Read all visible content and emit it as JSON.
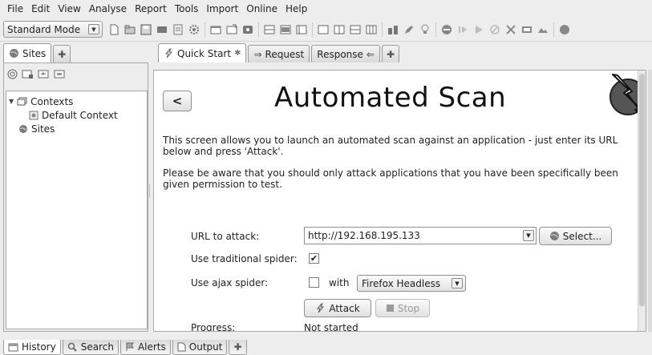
{
  "menubar": {
    "items": [
      {
        "label": "File"
      },
      {
        "label": "Edit"
      },
      {
        "label": "View"
      },
      {
        "label": "Analyse"
      },
      {
        "label": "Report"
      },
      {
        "label": "Tools"
      },
      {
        "label": "Import"
      },
      {
        "label": "Online"
      },
      {
        "label": "Help"
      }
    ]
  },
  "toolbar": {
    "mode_value": "Standard Mode"
  },
  "left_tabs": {
    "sites_label": "Sites"
  },
  "tree": {
    "contexts_label": "Contexts",
    "default_context_label": "Default Context",
    "sites_label": "Sites"
  },
  "right_tabs": {
    "quick_start_label": "Quick Start",
    "request_label": "Request",
    "response_label": "Response"
  },
  "quick_start": {
    "back_label": "<",
    "title": "Automated Scan",
    "intro": "This screen allows you to launch an automated scan against  an application - just enter its URL below and press 'Attack'.",
    "warning": "Please be aware that you should only attack applications that you have been specifically been given permission to test.",
    "url_label": "URL to attack:",
    "url_value": "http://192.168.195.133",
    "select_label": "Select...",
    "traditional_spider_label": "Use traditional spider:",
    "traditional_spider_checked": true,
    "ajax_spider_label": "Use ajax spider:",
    "ajax_spider_checked": false,
    "with_label": "with",
    "browser_value": "Firefox Headless",
    "attack_label": "Attack",
    "stop_label": "Stop",
    "progress_label": "Progress:",
    "progress_value": "Not started"
  },
  "bottom_tabs": {
    "history_label": "History",
    "search_label": "Search",
    "alerts_label": "Alerts",
    "output_label": "Output"
  }
}
